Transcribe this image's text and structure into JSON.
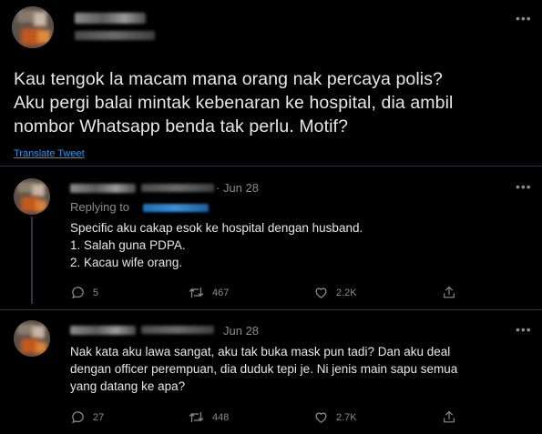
{
  "main_tweet": {
    "text_lines": [
      "Kau tengok la macam mana orang nak percaya polis?",
      "Aku pergi balai mintak kebenaran ke hospital, dia ambil",
      "nombor Whatsapp benda tak perlu. Motif?"
    ],
    "translate_label": "Translate Tweet",
    "more_icon": "more-dots-icon"
  },
  "replies": [
    {
      "date": "· Jun 28",
      "replying_label": "Replying to",
      "lines": [
        "Specific aku cakap esok ke hospital dengan husband.",
        "1. Salah guna PDPA.",
        "2. Kacau wife orang."
      ],
      "reply_count": "5",
      "retweet_count": "467",
      "like_count": "2.2K"
    },
    {
      "date": "Jun 28",
      "lines": [
        "Nak kata aku lawa sangat, aku tak buka mask pun tadi? Dan aku deal",
        "dengan officer perempuan, dia duduk tepi je. Ni jenis main sapu semua",
        "yang datang ke apa?"
      ],
      "reply_count": "27",
      "retweet_count": "448",
      "like_count": "2.7K"
    }
  ],
  "colors": {
    "background": "#000000",
    "text": "#e7e7e7",
    "muted": "#8b8b8b",
    "link": "#1d9bf0",
    "divider": "#2f3336"
  }
}
